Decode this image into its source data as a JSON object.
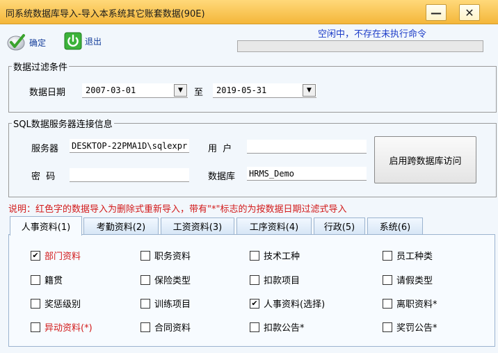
{
  "window": {
    "title": "同系统数据库导入-导入本系统其它账套数据(90E)",
    "minimize_glyph": "—",
    "close_glyph": "✕"
  },
  "toolbar": {
    "confirm_label": "确定",
    "exit_label": "退出"
  },
  "status": {
    "text": "空闲中，不存在未执行命令",
    "progress": 0
  },
  "filter": {
    "legend": "数据过滤条件",
    "date_label": "数据日期",
    "start_date": "2007-03-01",
    "to_label": "至",
    "end_date": "2019-05-31"
  },
  "sql": {
    "legend": "SQL数据服务器连接信息",
    "server_label": "服务器",
    "server_value": "DESKTOP-22PMA1D\\sqlexpr",
    "user_label": "用  户",
    "user_value": "",
    "password_label": "密  码",
    "password_value": "",
    "database_label": "数据库",
    "database_value": "HRMS_Demo",
    "cross_db_button": "启用跨数据库访问"
  },
  "note": "说明：红色字的数据导入为删除式重新导入，带有\"*\"标志的为按数据日期过滤式导入",
  "tabs": [
    {
      "label": "人事资料(1)",
      "active": true
    },
    {
      "label": "考勤资料(2)",
      "active": false
    },
    {
      "label": "工资资料(3)",
      "active": false
    },
    {
      "label": "工序资料(4)",
      "active": false
    },
    {
      "label": "行政(5)",
      "active": false
    },
    {
      "label": "系统(6)",
      "active": false
    }
  ],
  "checkboxes": [
    {
      "label": "部门资料",
      "checked": true,
      "red": true
    },
    {
      "label": "职务资料",
      "checked": false,
      "red": false
    },
    {
      "label": "技术工种",
      "checked": false,
      "red": false
    },
    {
      "label": "员工种类",
      "checked": false,
      "red": false
    },
    {
      "label": "籍贯",
      "checked": false,
      "red": false
    },
    {
      "label": "保险类型",
      "checked": false,
      "red": false
    },
    {
      "label": "扣款项目",
      "checked": false,
      "red": false
    },
    {
      "label": "请假类型",
      "checked": false,
      "red": false
    },
    {
      "label": "奖惩级别",
      "checked": false,
      "red": false
    },
    {
      "label": "训练项目",
      "checked": false,
      "red": false
    },
    {
      "label": "人事资料(选择)",
      "checked": true,
      "red": false
    },
    {
      "label": "离职资料*",
      "checked": false,
      "red": false
    },
    {
      "label": "异动资料(*)",
      "checked": false,
      "red": true
    },
    {
      "label": "合同资料",
      "checked": false,
      "red": false
    },
    {
      "label": "扣款公告*",
      "checked": false,
      "red": false
    },
    {
      "label": "奖罚公告*",
      "checked": false,
      "red": false
    }
  ],
  "check_glyph": "✔",
  "colors": {
    "title_bar": "#f4b73a",
    "status_text": "#1c3cc8",
    "note_red": "#d21a1a",
    "tab_border": "#9bb3cf"
  }
}
